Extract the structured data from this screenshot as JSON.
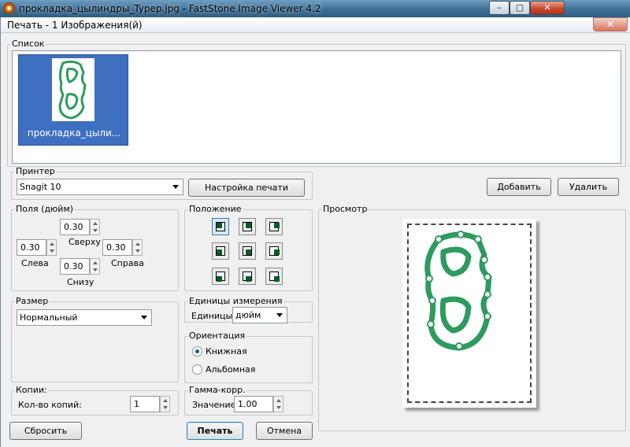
{
  "app_title": "прокладка_цылиндры_Typep.jpg  -  FastStone Image Viewer 4.2",
  "dialog_title": "Печать  -  1 Изображения(й)",
  "list": {
    "legend": "Список",
    "thumbnail_caption": "прокладка_цыли..."
  },
  "printer": {
    "legend": "Принтер",
    "selected": "Snagit 10",
    "setup_button": "Настройка печати"
  },
  "buttons": {
    "add": "Добавить",
    "delete": "Удалить",
    "reset": "Сбросить",
    "print": "Печать",
    "cancel": "Отмена"
  },
  "margins": {
    "legend": "Поля (дюйм)",
    "top_label": "Сверху",
    "top_value": "0.30",
    "left_label": "Слева",
    "left_value": "0.30",
    "right_label": "Справа",
    "right_value": "0.30",
    "bottom_label": "Снизу",
    "bottom_value": "0.30"
  },
  "position": {
    "legend": "Положение",
    "selected": "top-left"
  },
  "size": {
    "legend": "Размер",
    "selected": "Нормальный"
  },
  "units": {
    "legend": "Единицы измерения",
    "label": "Единицы:",
    "selected": "дюйм"
  },
  "orientation": {
    "legend": "Ориентация",
    "portrait": "Книжная",
    "landscape": "Альбомная",
    "selected": "portrait"
  },
  "copies": {
    "legend": "Копии:",
    "label": "Кол-во копий:",
    "value": "1"
  },
  "gamma": {
    "legend": "Гамма-корр.",
    "label": "Значение:",
    "value": "1.00"
  },
  "preview": {
    "legend": "Просмотр"
  },
  "colors": {
    "gasket_green": "#2e9b5e",
    "selection_blue": "#3f6fc1"
  }
}
